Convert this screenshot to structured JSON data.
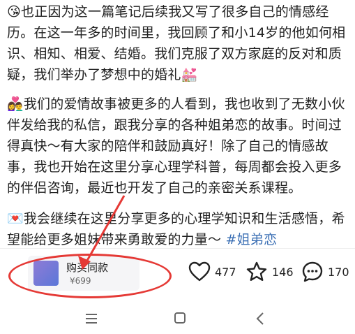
{
  "post": {
    "p1": "😘也正因为这一篇笔记后续我又写了很多自己的情感经历。在这一年多的时间里，我回顾了和小14岁的他如何相识、相知、相爱、结婚。我们克服了双方家庭的反对和质疑，我们举办了梦想中的婚礼💒",
    "p2": "👩‍❤️‍👨我们的爱情故事被更多的人看到，我也收到了无数小伙伴发给我的私信，跟我分享的各种姐弟恋的故事。时间过得真快～有大家的陪伴和鼓励真好！除了自己的情感故事，我也开始在这里分享心理学科普，每周都会投入更多的伴侣咨询，最近也开发了自己的亲密关系课程。",
    "p3_text": "💌我会继续在这里分享更多的心理学知识和生活感悟，希望能给更多姐妹带来勇敢爱的力量～",
    "p3_tag": "#姐弟恋"
  },
  "shop": {
    "title": "购买同款",
    "price": "¥699"
  },
  "actions": {
    "likes": "477",
    "collects": "146",
    "comments": "170"
  }
}
